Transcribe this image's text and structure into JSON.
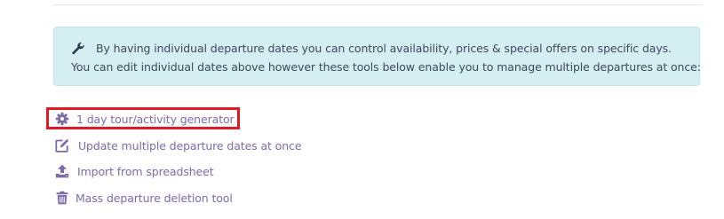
{
  "info": {
    "icon": "wrench-icon",
    "line1": "By having individual departure dates you can control availability, prices & special offers on specific days.",
    "line2": "You can edit individual dates above however these tools below enable you to manage multiple departures at once:"
  },
  "tools": [
    {
      "label": "1 day tour/activity generator",
      "icon": "gear-icon"
    },
    {
      "label": "Update multiple departure dates at once",
      "icon": "edit-icon"
    },
    {
      "label": "Import from spreadsheet",
      "icon": "upload-icon"
    },
    {
      "label": "Mass departure deletion tool",
      "icon": "trash-icon"
    }
  ],
  "colors": {
    "info_background": "#d5eef1",
    "link": "#7d6aaa",
    "highlight": "#e01a22"
  }
}
